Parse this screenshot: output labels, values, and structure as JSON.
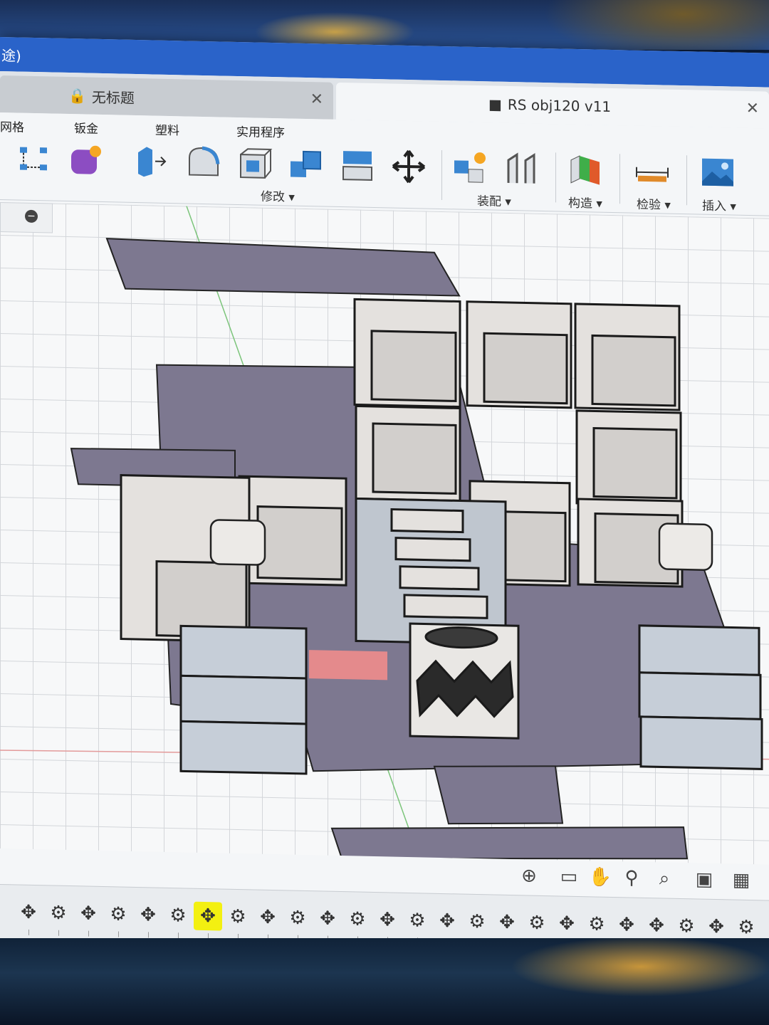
{
  "titlebar": {
    "app_name": "途)"
  },
  "tabs": [
    {
      "label": "无标题",
      "icon": "lock-icon",
      "active": false
    },
    {
      "label": "RS obj120 v11",
      "icon": "cube-icon",
      "active": true
    }
  ],
  "ribbon": {
    "categories": [
      "网格",
      "钣金",
      "塑料",
      "实用程序"
    ],
    "groups": [
      "修改 ▾",
      "装配 ▾",
      "构造 ▾",
      "检验 ▾",
      "插入 ▾"
    ]
  },
  "colors": {
    "titlebar": "#2a63c9",
    "accent_yellow": "#f3f011",
    "ribbon_blue": "#3a86d1"
  },
  "nav_tools": [
    "orbit-icon",
    "look-at-icon",
    "pan-icon",
    "zoom-icon",
    "fit-icon",
    "display-settings-icon",
    "grid-settings-icon"
  ],
  "timeline": {
    "selected_index": 6,
    "items": [
      "move-icon",
      "component-icon",
      "move-icon",
      "component-icon",
      "move-icon",
      "component-icon",
      "move-icon",
      "component-icon",
      "move-icon",
      "component-icon",
      "move-icon",
      "component-icon",
      "move-icon",
      "component-icon",
      "move-icon",
      "component-icon",
      "move-icon",
      "component-icon",
      "move-icon",
      "component-icon",
      "move-icon",
      "move-icon",
      "component-icon",
      "move-icon",
      "component-icon"
    ]
  }
}
